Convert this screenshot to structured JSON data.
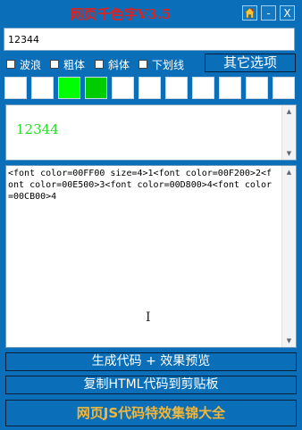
{
  "window": {
    "title": "网页千色字V3.5",
    "home_icon": "home-icon",
    "min_label": "-",
    "close_label": "X"
  },
  "input": {
    "value": "12344"
  },
  "options": [
    {
      "label": "波浪",
      "checked": false
    },
    {
      "label": "粗体",
      "checked": false
    },
    {
      "label": "斜体",
      "checked": false
    },
    {
      "label": "下划线",
      "checked": false
    }
  ],
  "other_options_label": "其它选项",
  "swatches": [
    "#ffffff",
    "#ffffff",
    "#00ff00",
    "#00cc00",
    "#ffffff",
    "#ffffff",
    "#ffffff",
    "#ffffff",
    "#ffffff",
    "#ffffff",
    "#ffffff"
  ],
  "preview": {
    "text": "12344",
    "color": "#27e027"
  },
  "code": {
    "text": "<font color=00FF00 size=4>1<font color=00F200>2<font color=00E500>3<font color=00D800>4<font color=00CB00>4"
  },
  "buttons": {
    "generate": "生成代码 + 效果预览",
    "copy": "复制HTML代码到剪贴板",
    "js_collection": "网页JS代码特效集锦大全"
  }
}
